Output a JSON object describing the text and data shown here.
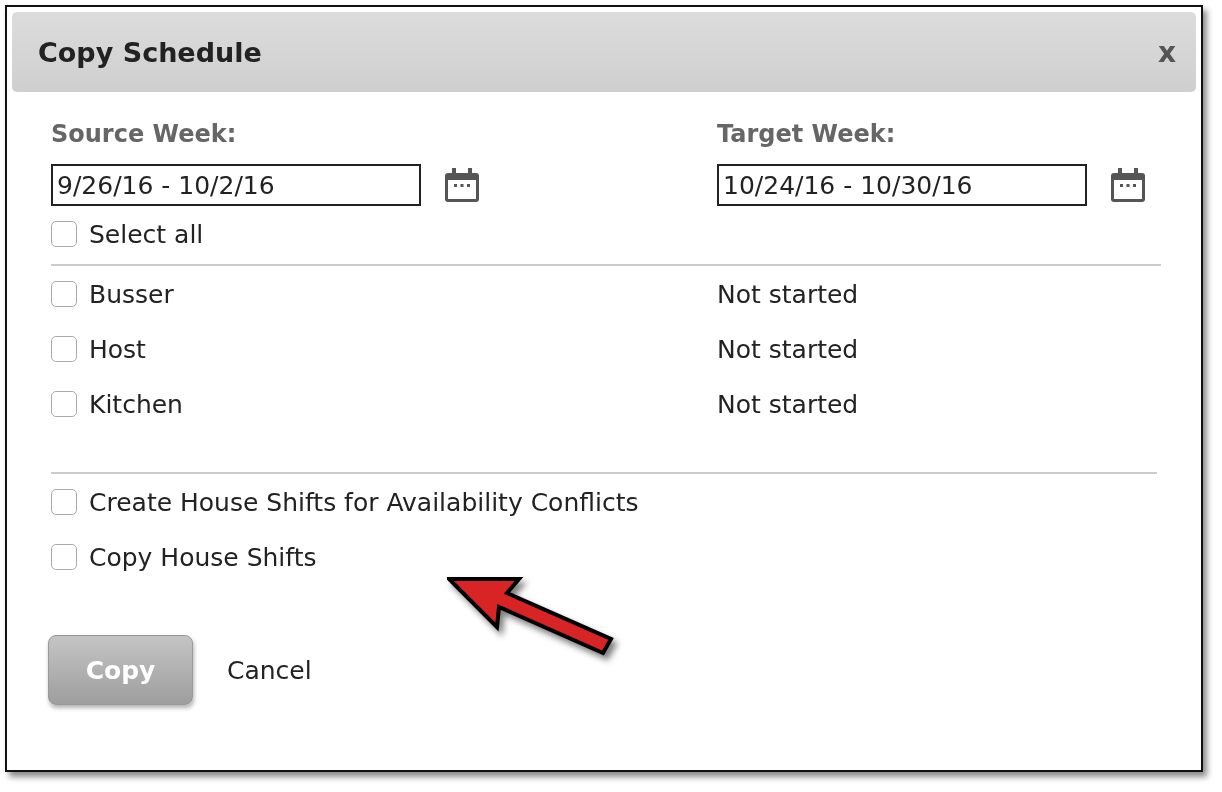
{
  "dialog": {
    "title": "Copy Schedule",
    "close": "x"
  },
  "source_week": {
    "label": "Source Week:",
    "value": "9/26/16 - 10/2/16"
  },
  "target_week": {
    "label": "Target Week:",
    "value": "10/24/16 - 10/30/16"
  },
  "select_all": {
    "label": "Select all",
    "checked": false
  },
  "roles": [
    {
      "label": "Busser",
      "checked": false,
      "status": "Not started"
    },
    {
      "label": "Host",
      "checked": false,
      "status": "Not started"
    },
    {
      "label": "Kitchen",
      "checked": false,
      "status": "Not started"
    }
  ],
  "options": [
    {
      "label": "Create House Shifts for Availability Conflicts",
      "checked": false
    },
    {
      "label": "Copy House Shifts",
      "checked": false
    }
  ],
  "buttons": {
    "copy": {
      "label": "Copy",
      "disabled": true
    },
    "cancel": "Cancel"
  },
  "annotation": {
    "kind": "arrow"
  }
}
